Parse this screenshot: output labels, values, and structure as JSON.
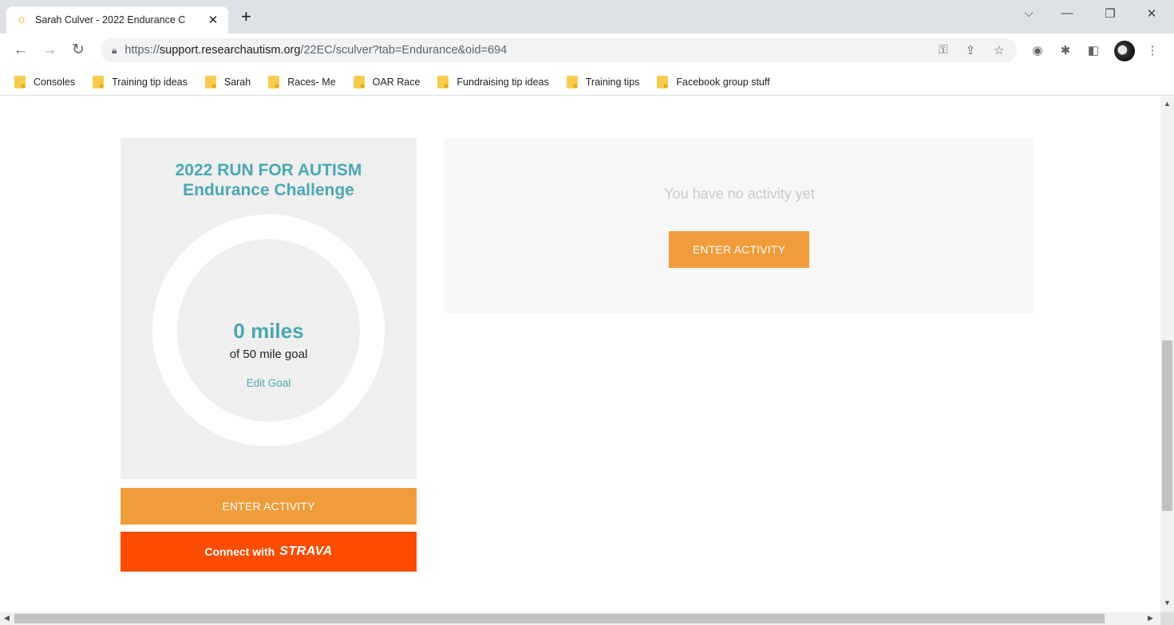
{
  "browser": {
    "tab_title": "Sarah Culver - 2022 Endurance C",
    "url_prefix": "https://",
    "url_host": "support.researchautism.org",
    "url_path": "/22EC/sculver?tab=Endurance&oid=694",
    "bookmarks": [
      "Consoles",
      "Training tip ideas",
      "Sarah",
      "Races- Me",
      "OAR Race",
      "Fundraising tip ideas",
      "Training tips",
      "Facebook group stuff"
    ]
  },
  "challenge": {
    "title_line1": "2022 RUN FOR AUTISM",
    "title_line2": "Endurance Challenge",
    "miles": "0 miles",
    "goal": "of 50 mile goal",
    "edit_goal": "Edit Goal",
    "progress_fraction": 0
  },
  "buttons": {
    "enter_activity": "ENTER ACTIVITY",
    "connect_with": "Connect with",
    "strava_logo": "STRAVA"
  },
  "activity": {
    "empty_message": "You have no activity yet"
  },
  "colors": {
    "accent_teal": "#4aa8b3",
    "button_orange": "#f09c3b",
    "strava_orange": "#fc4c02"
  }
}
